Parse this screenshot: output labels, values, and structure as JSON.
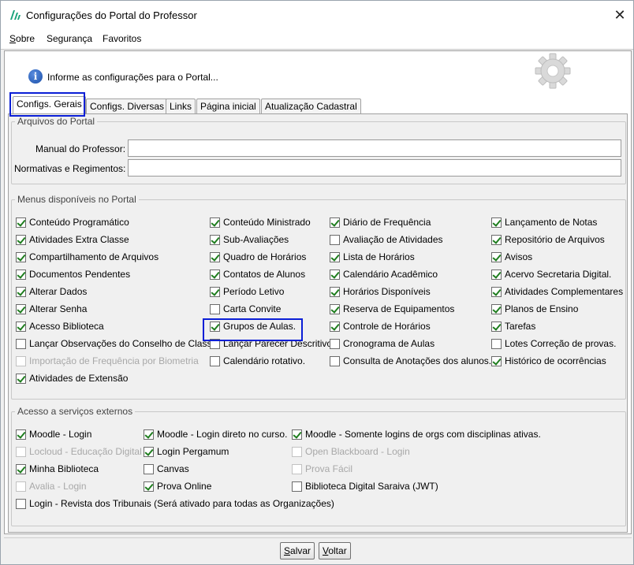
{
  "window": {
    "title": "Configurações do Portal do Professor",
    "close_glyph": "✕"
  },
  "menu": {
    "items": [
      "Sobre",
      "Segurança",
      "Favoritos"
    ]
  },
  "info": {
    "text": "Informe as configurações para o Portal...",
    "icon": "i"
  },
  "tabs": [
    "Configs. Gerais",
    "Configs. Diversas",
    "Links",
    "Página inicial",
    "Atualização Cadastral"
  ],
  "arquivos": {
    "title": "Arquivos do Portal",
    "manual_label": "Manual do Professor:",
    "manual_value": "",
    "normativas_label": "Normativas e Regimentos:",
    "normativas_value": ""
  },
  "menus": {
    "title": "Menus disponíveis no Portal",
    "columns": [
      [
        {
          "label": "Conteúdo Programático",
          "checked": true
        },
        {
          "label": "Atividades Extra Classe",
          "checked": true
        },
        {
          "label": "Compartilhamento de Arquivos",
          "checked": true
        },
        {
          "label": "Documentos Pendentes",
          "checked": true
        },
        {
          "label": "Alterar Dados",
          "checked": true
        },
        {
          "label": "Alterar Senha",
          "checked": true
        },
        {
          "label": "Acesso Biblioteca",
          "checked": true
        },
        {
          "label": "Lançar Observações do Conselho de Classe",
          "checked": false
        },
        {
          "label": "Importação de Frequência por Biometria",
          "checked": false,
          "disabled": true
        },
        {
          "label": "Atividades de Extensão",
          "checked": true
        }
      ],
      [
        {
          "label": "Conteúdo Ministrado",
          "checked": true
        },
        {
          "label": "Sub-Avaliações",
          "checked": true
        },
        {
          "label": "Quadro de Horários",
          "checked": true
        },
        {
          "label": "Contatos de Alunos",
          "checked": true
        },
        {
          "label": "Período Letivo",
          "checked": true
        },
        {
          "label": "Carta Convite",
          "checked": false
        },
        {
          "label": "Grupos de Aulas.",
          "checked": true
        },
        {
          "label": "Lançar Parecer Descritivo",
          "checked": false
        },
        {
          "label": "Calendário rotativo.",
          "checked": false
        }
      ],
      [
        {
          "label": "Diário de Frequência",
          "checked": true
        },
        {
          "label": "Avaliação de Atividades",
          "checked": false
        },
        {
          "label": "Lista de Horários",
          "checked": true
        },
        {
          "label": "Calendário Acadêmico",
          "checked": true
        },
        {
          "label": "Horários Disponíveis",
          "checked": true
        },
        {
          "label": "Reserva de Equipamentos",
          "checked": true
        },
        {
          "label": "Controle de Horários",
          "checked": true
        },
        {
          "label": "Cronograma de Aulas",
          "checked": false
        },
        {
          "label": "Consulta de Anotações dos alunos.",
          "checked": false
        }
      ],
      [
        {
          "label": "Lançamento de Notas",
          "checked": true
        },
        {
          "label": "Repositório de Arquivos",
          "checked": true
        },
        {
          "label": "Avisos",
          "checked": true
        },
        {
          "label": "Acervo Secretaria Digital.",
          "checked": true
        },
        {
          "label": "Atividades Complementares",
          "checked": true
        },
        {
          "label": "Planos de Ensino",
          "checked": true
        },
        {
          "label": "Tarefas",
          "checked": true
        },
        {
          "label": "Lotes Correção de provas.",
          "checked": false
        },
        {
          "label": "Histórico de ocorrências",
          "checked": true
        }
      ]
    ]
  },
  "externos": {
    "title": "Acesso a serviços externos",
    "columns": [
      [
        {
          "label": "Moodle - Login",
          "checked": true
        },
        {
          "label": "Locloud - Educação Digital",
          "checked": false,
          "disabled": true
        },
        {
          "label": "Minha Biblioteca",
          "checked": true
        },
        {
          "label": "Avalia - Login",
          "checked": false,
          "disabled": true
        },
        {
          "label": "Login - Revista dos Tribunais (Será ativado para todas as Organizações)",
          "checked": false
        }
      ],
      [
        {
          "label": "Moodle - Login direto no curso.",
          "checked": true
        },
        {
          "label": "Login Pergamum",
          "checked": true
        },
        {
          "label": "Canvas",
          "checked": false
        },
        {
          "label": "Prova Online",
          "checked": true
        }
      ],
      [
        {
          "label": "Moodle - Somente logins de orgs com disciplinas ativas.",
          "checked": true
        },
        {
          "label": "Open Blackboard - Login",
          "checked": false,
          "disabled": true
        },
        {
          "label": "Prova Fácil",
          "checked": false,
          "disabled": true
        },
        {
          "label": "Biblioteca Digital Saraiva (JWT)",
          "checked": false
        }
      ]
    ]
  },
  "buttons": {
    "save": "Salvar",
    "back": "Voltar"
  },
  "colors": {
    "highlight": "#0b1fd6",
    "check": "#1e7d1e",
    "app_icon": "#1aa37a"
  }
}
